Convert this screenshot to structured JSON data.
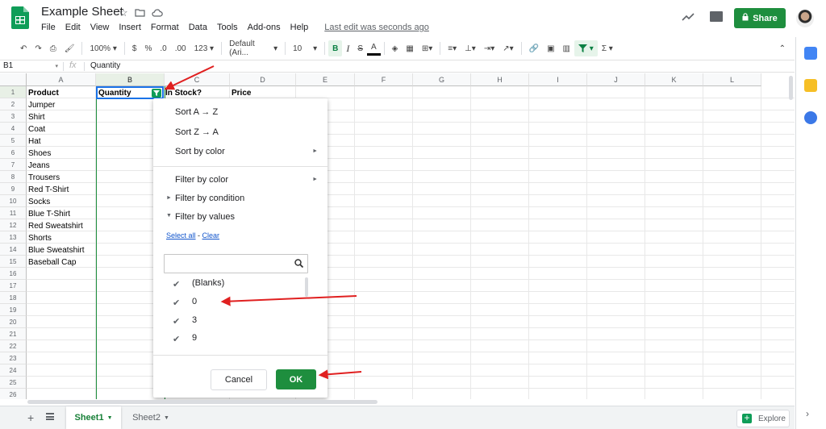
{
  "header": {
    "title": "Example Sheet",
    "menu": [
      "File",
      "Edit",
      "View",
      "Insert",
      "Format",
      "Data",
      "Tools",
      "Add-ons",
      "Help"
    ],
    "last_edit": "Last edit was seconds ago",
    "share_label": "Share"
  },
  "toolbar": {
    "zoom": "100%",
    "currency": "$",
    "percent": "%",
    "dec_less": ".0",
    "dec_more": ".00",
    "more_formats": "123",
    "font": "Default (Ari...",
    "font_size": "10",
    "bold": "B",
    "italic": "I",
    "strike": "S",
    "text_color": "A",
    "sum": "Σ"
  },
  "formula_bar": {
    "cell_ref": "B1",
    "fx": "fx",
    "value": "Quantity"
  },
  "grid": {
    "columns": [
      "A",
      "B",
      "C",
      "D",
      "E",
      "F",
      "G",
      "H",
      "I",
      "J",
      "K",
      "L"
    ],
    "rows": [
      "1",
      "2",
      "3",
      "4",
      "5",
      "6",
      "7",
      "8",
      "9",
      "10",
      "11",
      "12",
      "13",
      "14",
      "15",
      "16",
      "17",
      "18",
      "19",
      "20",
      "21",
      "22",
      "23",
      "24",
      "25",
      "26"
    ],
    "headers": [
      "Product",
      "Quantity",
      "In Stock?",
      "Price"
    ],
    "products": [
      "Jumper",
      "Shirt",
      "Coat",
      "Hat",
      "Shoes",
      "Jeans",
      "Trousers",
      "Red T-Shirt",
      "Socks",
      "Blue T-Shirt",
      "Red Sweatshirt",
      "Shorts",
      "Blue Sweatshirt",
      "Baseball Cap"
    ]
  },
  "filter_menu": {
    "sort_az": "Sort A → Z",
    "sort_za": "Sort Z → A",
    "sort_color": "Sort by color",
    "filter_color": "Filter by color",
    "filter_condition": "Filter by condition",
    "filter_values": "Filter by values",
    "select_all": "Select all",
    "dash": " - ",
    "clear": "Clear",
    "values": [
      "(Blanks)",
      "0",
      "3",
      "9"
    ],
    "cancel": "Cancel",
    "ok": "OK"
  },
  "tabs": {
    "sheet1": "Sheet1",
    "sheet2": "Sheet2",
    "explore": "Explore"
  },
  "colors": {
    "accent": "#1e8e3e",
    "annotation": "#e02020",
    "selection": "#1a73e8"
  }
}
